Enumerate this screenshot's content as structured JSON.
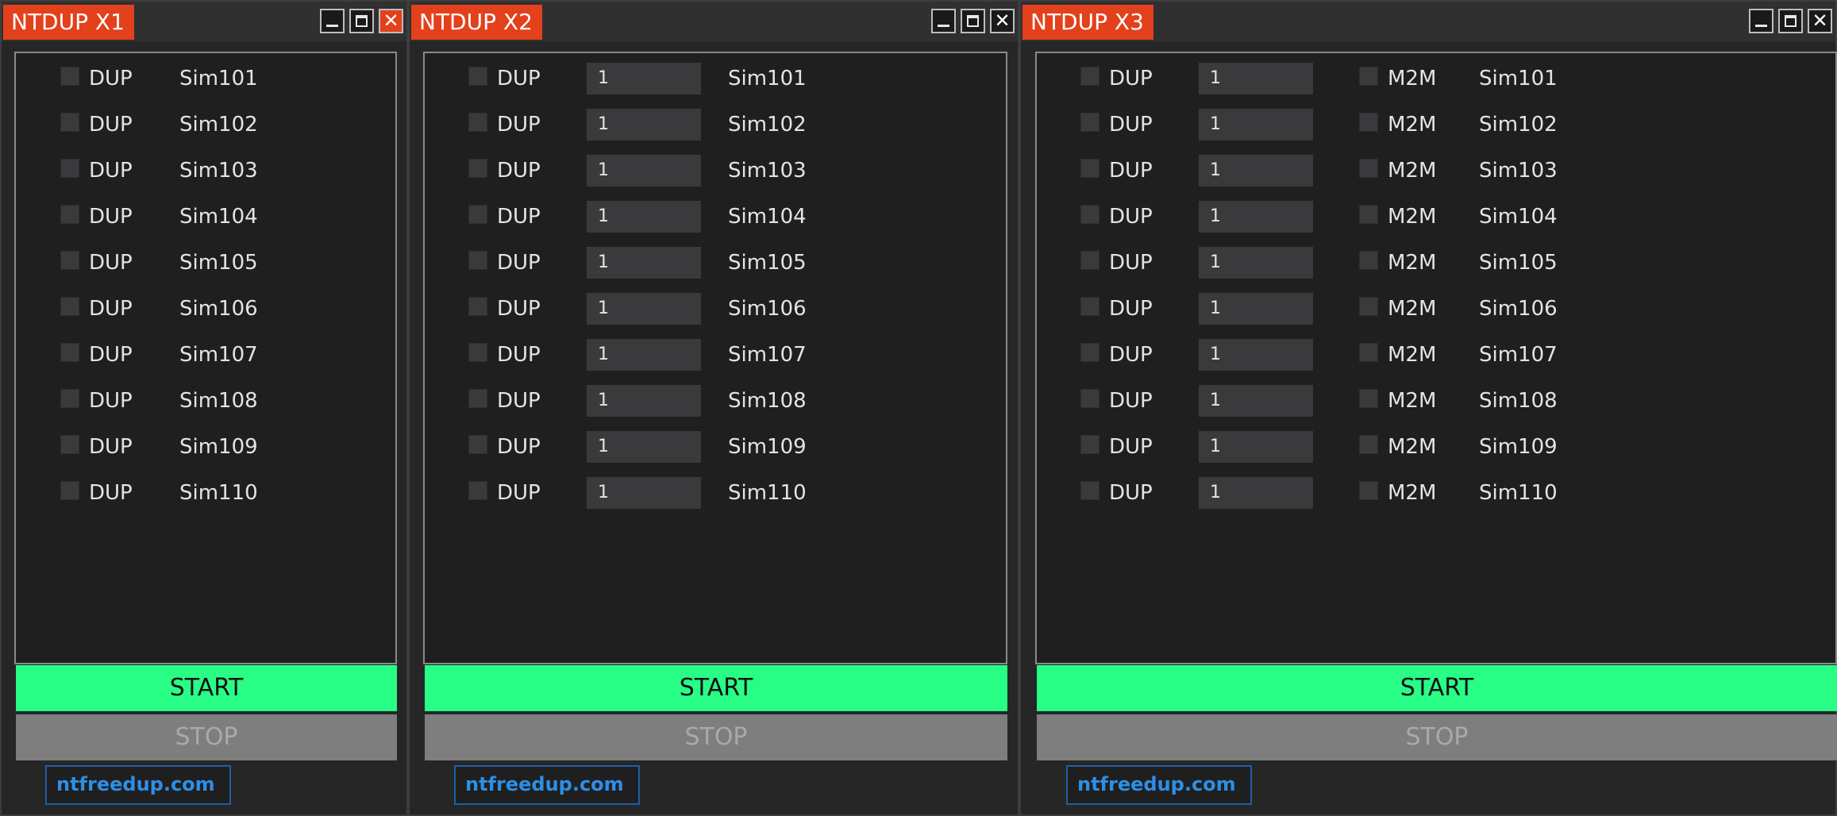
{
  "windows": [
    {
      "title": "NTDUP X1",
      "close_glyph": "✕",
      "dup_label": "DUP",
      "rows": [
        "Sim101",
        "Sim102",
        "Sim103",
        "Sim104",
        "Sim105",
        "Sim106",
        "Sim107",
        "Sim108",
        "Sim109",
        "Sim110"
      ],
      "start_label": "START",
      "stop_label": "STOP",
      "link_text": "ntfreedup.com"
    },
    {
      "title": "NTDUP X2",
      "close_glyph": "✕",
      "dup_label": "DUP",
      "qty_values": [
        "1",
        "1",
        "1",
        "1",
        "1",
        "1",
        "1",
        "1",
        "1",
        "1"
      ],
      "rows": [
        "Sim101",
        "Sim102",
        "Sim103",
        "Sim104",
        "Sim105",
        "Sim106",
        "Sim107",
        "Sim108",
        "Sim109",
        "Sim110"
      ],
      "start_label": "START",
      "stop_label": "STOP",
      "link_text": "ntfreedup.com"
    },
    {
      "title": "NTDUP X3",
      "close_glyph": "✕",
      "dup_label": "DUP",
      "m2m_label": "M2M",
      "qty_values": [
        "1",
        "1",
        "1",
        "1",
        "1",
        "1",
        "1",
        "1",
        "1",
        "1"
      ],
      "rows": [
        "Sim101",
        "Sim102",
        "Sim103",
        "Sim104",
        "Sim105",
        "Sim106",
        "Sim107",
        "Sim108",
        "Sim109",
        "Sim110"
      ],
      "start_label": "START",
      "stop_label": "STOP",
      "link_text": "ntfreedup.com"
    }
  ],
  "colors": {
    "title_accent": "#e3401c",
    "start_green": "#28fd85",
    "stop_gray": "#7e7e7e",
    "link_blue": "#2d8fe6"
  }
}
